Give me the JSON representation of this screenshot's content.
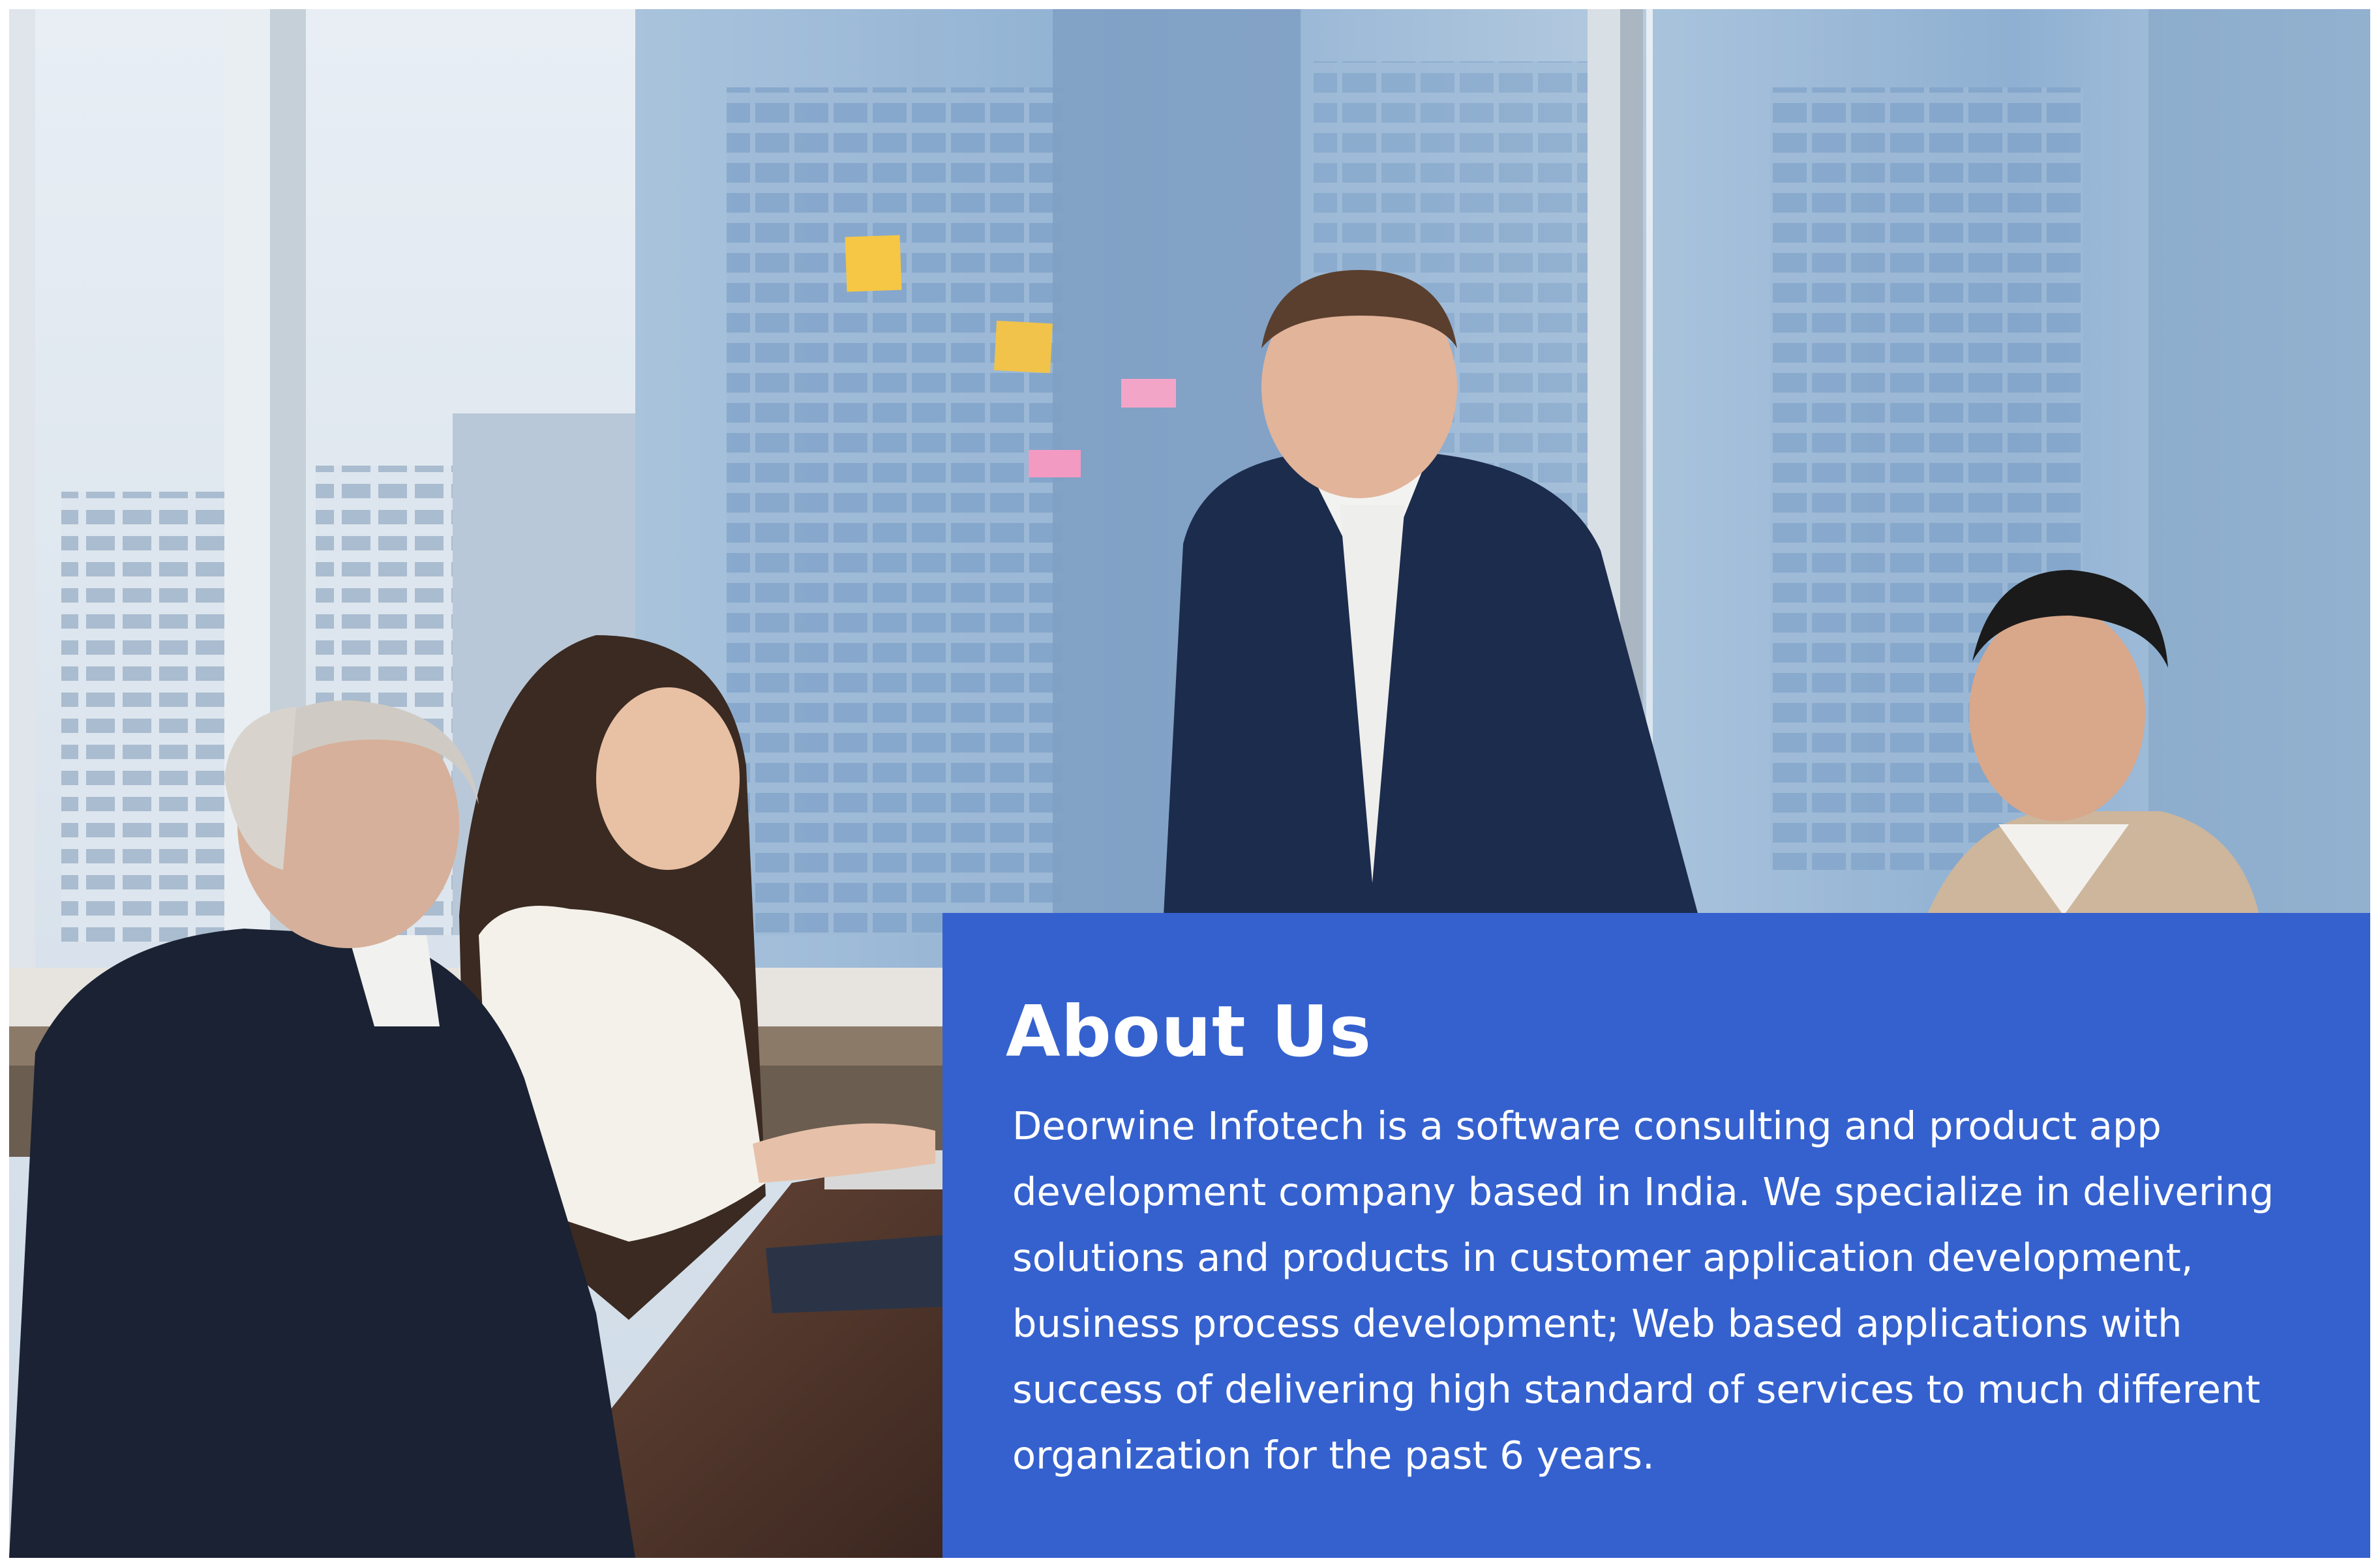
{
  "about": {
    "heading": "About Us",
    "description": "Deorwine Infotech is a software consulting and product app development company based in India. We specialize in delivering solutions and products in customer application development, business process development; Web based applications with success of delivering high standard of services to much different organization for the past 6 years."
  },
  "colors": {
    "panel_background": "#3561cf",
    "panel_text": "#ffffff"
  }
}
